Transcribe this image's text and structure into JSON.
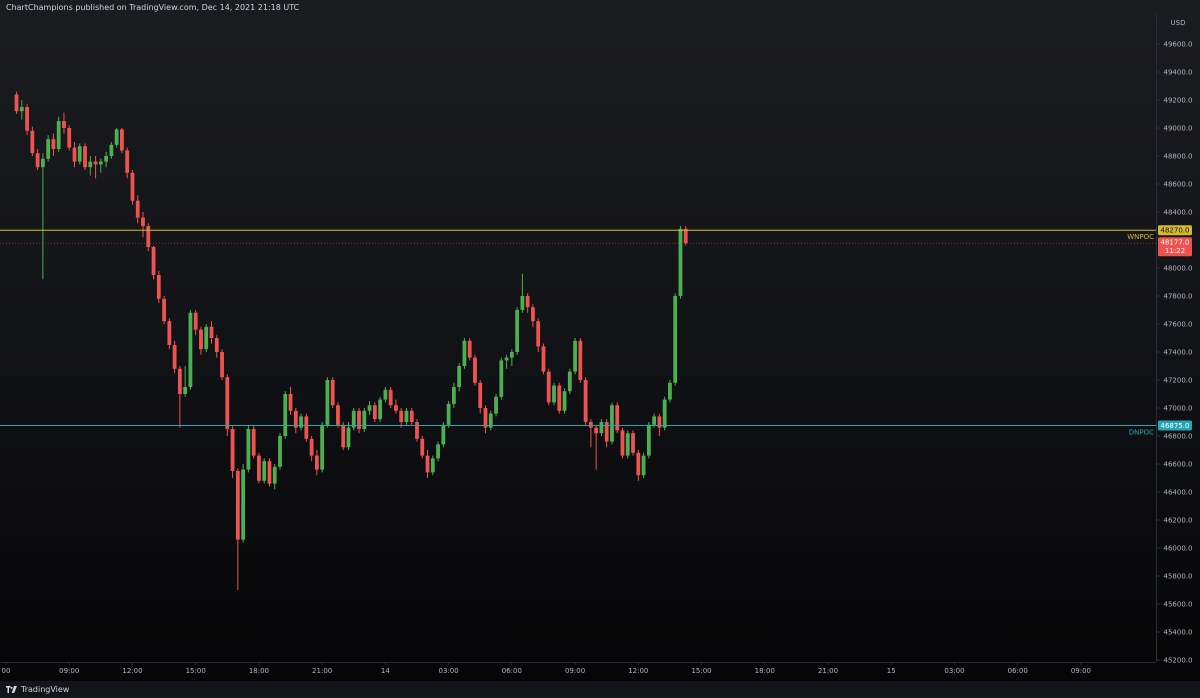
{
  "header": {
    "publisher_text": "ChartChampions published on TradingView.com, Dec 14, 2021 21:18 UTC"
  },
  "footer": {
    "brand": "TradingView",
    "logo_icon": "tradingview-logo-icon"
  },
  "colors": {
    "up": "#4caf50",
    "down": "#ef5350",
    "wnpoc_line": "#d4b92e",
    "dnpoc_line": "#26a6b5",
    "current_price": "#ef5350",
    "axis_text": "#b2b5be",
    "axis_line": "#2a2e39"
  },
  "chart_data": {
    "type": "candlestick",
    "currency_label": "USD",
    "ylim": [
      45200,
      49800
    ],
    "y_ticks": [
      45200,
      45400,
      45600,
      45800,
      46000,
      46200,
      46400,
      46600,
      46800,
      47000,
      47200,
      47400,
      47600,
      47800,
      48000,
      48200,
      48400,
      48600,
      48800,
      49000,
      49200,
      49400,
      49600
    ],
    "y_tick_labels": [
      "45200.0",
      "45400.0",
      "45600.0",
      "45800.0",
      "46000.0",
      "46200.0",
      "46400.0",
      "46600.0",
      "46800.0",
      "47000.0",
      "47200.0",
      "47400.0",
      "47600.0",
      "47800.0",
      "48000.0",
      "48200.0",
      "48400.0",
      "48600.0",
      "48800.0",
      "49000.0",
      "49200.0",
      "49400.0",
      "49600.0"
    ],
    "xlim": [
      "2021-12-13 06:00",
      "2021-12-15 10:00"
    ],
    "x_ticks": [
      "2021-12-13 06:00",
      "2021-12-13 09:00",
      "2021-12-13 12:00",
      "2021-12-13 15:00",
      "2021-12-13 18:00",
      "2021-12-13 21:00",
      "2021-12-14 00:00",
      "2021-12-14 03:00",
      "2021-12-14 06:00",
      "2021-12-14 09:00",
      "2021-12-14 12:00",
      "2021-12-14 15:00",
      "2021-12-14 18:00",
      "2021-12-14 21:00",
      "2021-12-15 00:00",
      "2021-12-15 03:00",
      "2021-12-15 06:00",
      "2021-12-15 09:00"
    ],
    "x_tick_labels": [
      "00",
      "09:00",
      "12:00",
      "15:00",
      "18:00",
      "21:00",
      "14",
      "03:00",
      "06:00",
      "09:00",
      "12:00",
      "15:00",
      "18:00",
      "21:00",
      "15",
      "03:00",
      "06:00",
      "09:00"
    ],
    "candle_interval_minutes": 15,
    "first_candle_time": "2021-12-13 06:30",
    "candles": [
      [
        49240,
        49260,
        49100,
        49120
      ],
      [
        49120,
        49200,
        49060,
        49150
      ],
      [
        49150,
        49170,
        48950,
        48980
      ],
      [
        48980,
        49010,
        48800,
        48820
      ],
      [
        48820,
        48850,
        48700,
        48720
      ],
      [
        48720,
        48820,
        47920,
        48780
      ],
      [
        48780,
        48950,
        48760,
        48920
      ],
      [
        48920,
        48960,
        48800,
        48850
      ],
      [
        48850,
        49080,
        48830,
        49050
      ],
      [
        49050,
        49110,
        48960,
        49000
      ],
      [
        49000,
        49020,
        48840,
        48860
      ],
      [
        48860,
        48900,
        48720,
        48760
      ],
      [
        48760,
        48890,
        48740,
        48870
      ],
      [
        48870,
        48890,
        48700,
        48720
      ],
      [
        48720,
        48800,
        48660,
        48760
      ],
      [
        48760,
        48800,
        48640,
        48740
      ],
      [
        48740,
        48780,
        48680,
        48760
      ],
      [
        48760,
        48830,
        48720,
        48800
      ],
      [
        48800,
        48900,
        48780,
        48880
      ],
      [
        48880,
        49000,
        48860,
        48990
      ],
      [
        48990,
        49000,
        48820,
        48840
      ],
      [
        48840,
        48860,
        48640,
        48680
      ],
      [
        48680,
        48700,
        48450,
        48480
      ],
      [
        48480,
        48520,
        48320,
        48360
      ],
      [
        48360,
        48400,
        48220,
        48300
      ],
      [
        48300,
        48320,
        48120,
        48150
      ],
      [
        48150,
        48160,
        47920,
        47950
      ],
      [
        47950,
        47980,
        47750,
        47780
      ],
      [
        47780,
        47800,
        47600,
        47620
      ],
      [
        47620,
        47640,
        47420,
        47450
      ],
      [
        47450,
        47480,
        47250,
        47280
      ],
      [
        47280,
        47300,
        46860,
        47100
      ],
      [
        47100,
        47300,
        47080,
        47150
      ],
      [
        47150,
        47700,
        47130,
        47680
      ],
      [
        47680,
        47700,
        47520,
        47560
      ],
      [
        47560,
        47580,
        47380,
        47420
      ],
      [
        47420,
        47600,
        47400,
        47580
      ],
      [
        47580,
        47620,
        47460,
        47500
      ],
      [
        47500,
        47520,
        47360,
        47400
      ],
      [
        47400,
        47420,
        47200,
        47220
      ],
      [
        47220,
        47240,
        46800,
        46850
      ],
      [
        46850,
        46870,
        46500,
        46550
      ],
      [
        46550,
        46570,
        45700,
        46060
      ],
      [
        46060,
        46600,
        46040,
        46560
      ],
      [
        46560,
        46880,
        46540,
        46850
      ],
      [
        46850,
        46870,
        46640,
        46660
      ],
      [
        46660,
        46680,
        46460,
        46480
      ],
      [
        46480,
        46640,
        46460,
        46620
      ],
      [
        46620,
        46640,
        46440,
        46460
      ],
      [
        46460,
        46600,
        46420,
        46580
      ],
      [
        46580,
        46820,
        46560,
        46800
      ],
      [
        46800,
        47120,
        46780,
        47100
      ],
      [
        47100,
        47150,
        46950,
        46980
      ],
      [
        46980,
        47000,
        46820,
        46860
      ],
      [
        46860,
        46960,
        46840,
        46940
      ],
      [
        46940,
        46960,
        46760,
        46780
      ],
      [
        46780,
        46800,
        46620,
        46660
      ],
      [
        46660,
        46700,
        46520,
        46560
      ],
      [
        46560,
        46900,
        46540,
        46880
      ],
      [
        46880,
        47220,
        46860,
        47200
      ],
      [
        47200,
        47220,
        47000,
        47020
      ],
      [
        47020,
        47040,
        46860,
        46880
      ],
      [
        46880,
        46900,
        46700,
        46720
      ],
      [
        46720,
        46900,
        46700,
        46860
      ],
      [
        46860,
        47000,
        46840,
        46980
      ],
      [
        46980,
        47000,
        46820,
        46850
      ],
      [
        46850,
        47000,
        46830,
        46980
      ],
      [
        46980,
        47050,
        46950,
        47020
      ],
      [
        47020,
        47040,
        46900,
        46920
      ],
      [
        46920,
        47080,
        46900,
        47060
      ],
      [
        47060,
        47150,
        47040,
        47130
      ],
      [
        47130,
        47150,
        47000,
        47020
      ],
      [
        47020,
        47060,
        46960,
        46980
      ],
      [
        46980,
        47000,
        46860,
        46900
      ],
      [
        46900,
        47000,
        46880,
        46980
      ],
      [
        46980,
        47000,
        46880,
        46900
      ],
      [
        46900,
        46920,
        46760,
        46780
      ],
      [
        46780,
        46800,
        46640,
        46660
      ],
      [
        46660,
        46700,
        46500,
        46540
      ],
      [
        46540,
        46660,
        46520,
        46640
      ],
      [
        46640,
        46760,
        46620,
        46740
      ],
      [
        46740,
        46900,
        46720,
        46880
      ],
      [
        46880,
        47050,
        46860,
        47030
      ],
      [
        47030,
        47180,
        47000,
        47150
      ],
      [
        47150,
        47320,
        47120,
        47300
      ],
      [
        47300,
        47500,
        47280,
        47480
      ],
      [
        47480,
        47500,
        47340,
        47360
      ],
      [
        47360,
        47380,
        47160,
        47180
      ],
      [
        47180,
        47200,
        46960,
        47000
      ],
      [
        47000,
        47020,
        46820,
        46860
      ],
      [
        46860,
        46980,
        46840,
        46960
      ],
      [
        46960,
        47100,
        46940,
        47080
      ],
      [
        47080,
        47360,
        47060,
        47340
      ],
      [
        47340,
        47380,
        47280,
        47360
      ],
      [
        47360,
        47420,
        47300,
        47400
      ],
      [
        47400,
        47720,
        47380,
        47700
      ],
      [
        47700,
        47960,
        47680,
        47800
      ],
      [
        47800,
        47820,
        47680,
        47720
      ],
      [
        47720,
        47740,
        47580,
        47620
      ],
      [
        47620,
        47640,
        47400,
        47440
      ],
      [
        47440,
        47460,
        47240,
        47260
      ],
      [
        47260,
        47280,
        47020,
        47040
      ],
      [
        47040,
        47180,
        47020,
        47160
      ],
      [
        47160,
        47180,
        46960,
        46980
      ],
      [
        46980,
        47140,
        46960,
        47120
      ],
      [
        47120,
        47280,
        47100,
        47260
      ],
      [
        47260,
        47500,
        47240,
        47480
      ],
      [
        47480,
        47500,
        47180,
        47200
      ],
      [
        47200,
        47220,
        46880,
        46900
      ],
      [
        46900,
        46920,
        46720,
        46860
      ],
      [
        46860,
        46880,
        46560,
        46820
      ],
      [
        46820,
        46920,
        46800,
        46900
      ],
      [
        46900,
        46920,
        46720,
        46760
      ],
      [
        46760,
        47040,
        46740,
        47020
      ],
      [
        47020,
        47040,
        46820,
        46840
      ],
      [
        46840,
        46860,
        46640,
        46660
      ],
      [
        46660,
        46840,
        46640,
        46820
      ],
      [
        46820,
        46840,
        46660,
        46680
      ],
      [
        46680,
        46700,
        46480,
        46520
      ],
      [
        46520,
        46680,
        46500,
        46660
      ],
      [
        46660,
        46900,
        46640,
        46880
      ],
      [
        46880,
        46960,
        46860,
        46940
      ],
      [
        46940,
        46960,
        46800,
        46860
      ],
      [
        46860,
        47080,
        46840,
        47060
      ],
      [
        47060,
        47200,
        47040,
        47180
      ],
      [
        47180,
        47820,
        47160,
        47800
      ],
      [
        47800,
        48300,
        47780,
        48280
      ],
      [
        48280,
        48300,
        48160,
        48177
      ]
    ],
    "lines": [
      {
        "name": "WNPOC",
        "value": 48270,
        "label": "48270.0"
      },
      {
        "name": "DNPOC",
        "value": 46875,
        "label": "46875.0"
      }
    ],
    "current_price": {
      "value": 48177,
      "label": "48177.0",
      "countdown": "11:22"
    },
    "grid": false
  }
}
